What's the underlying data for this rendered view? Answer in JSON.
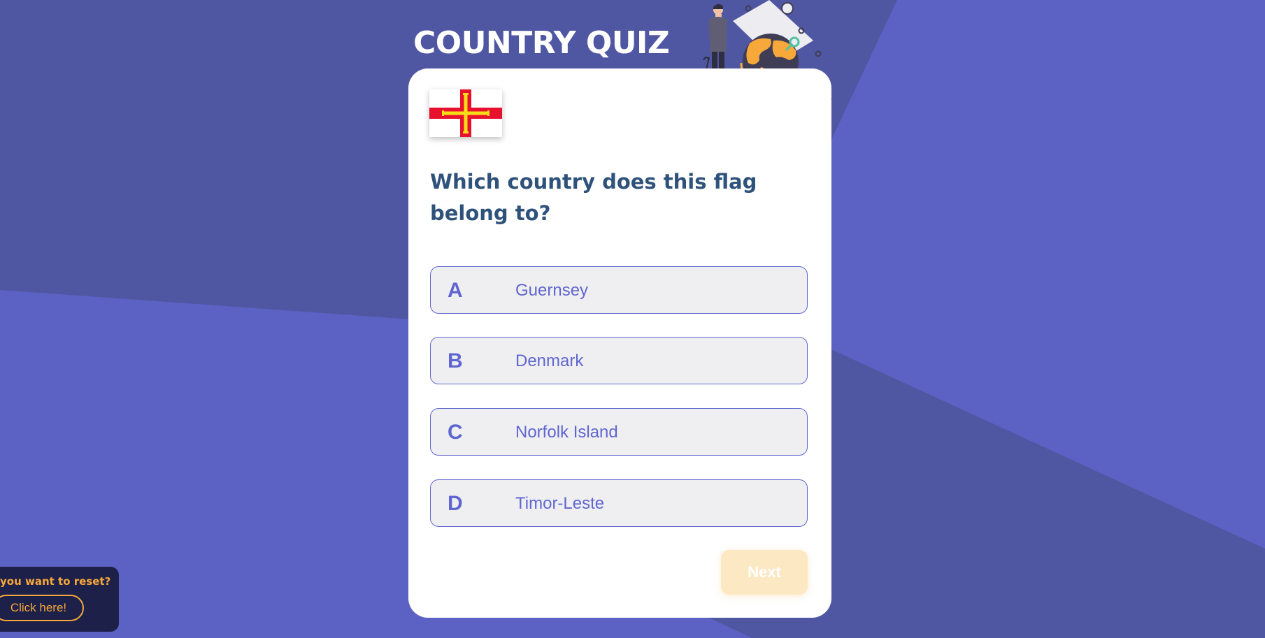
{
  "page": {
    "title": "COUNTRY QUIZ"
  },
  "quiz": {
    "flag": "Guernsey flag",
    "question": "Which country does this flag belong to?",
    "options": [
      {
        "letter": "A",
        "text": "Guernsey"
      },
      {
        "letter": "B",
        "text": "Denmark"
      },
      {
        "letter": "C",
        "text": "Norfolk Island"
      },
      {
        "letter": "D",
        "text": "Timor-Leste"
      }
    ],
    "next_label": "Next"
  },
  "reset": {
    "prompt": "you want to reset?",
    "button_label": "Click here!"
  },
  "icons": [
    "traveler-globe-illustration",
    "flag-icon"
  ],
  "colors": {
    "background": "#5b62c4",
    "background_dark": "#5057a2",
    "card": "#ffffff",
    "accent": "#6066d0",
    "question_text": "#2f527b",
    "next_button": "#fde8c4",
    "reset_panel": "#1d2048",
    "reset_accent": "#f6a83a"
  }
}
